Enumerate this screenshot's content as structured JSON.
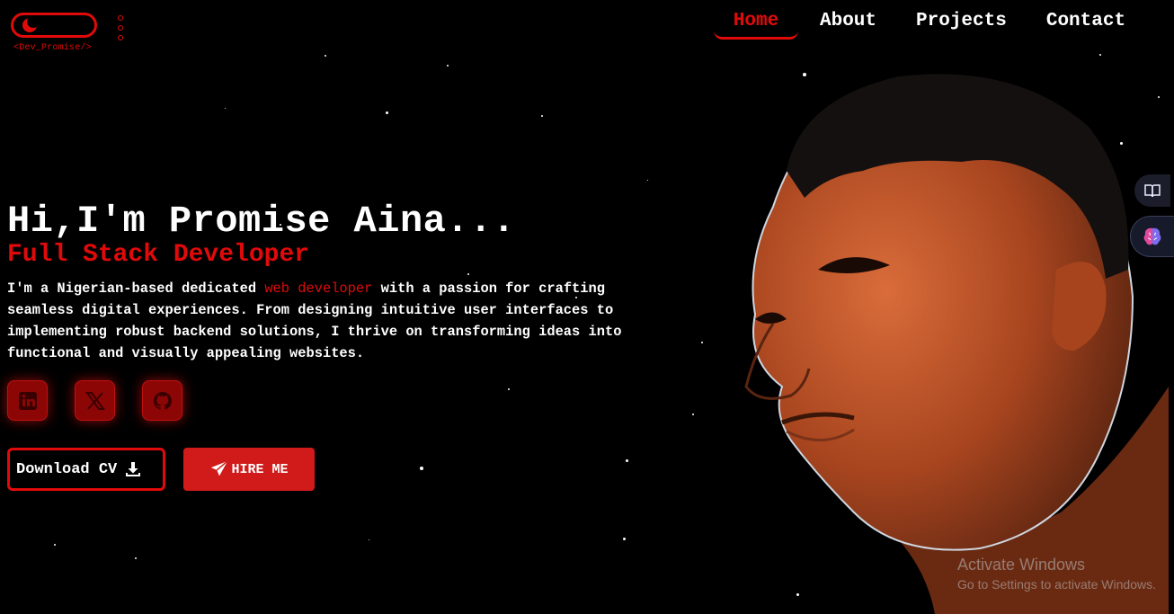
{
  "header": {
    "logo_text": "<Dev_Promise/>",
    "nav": [
      {
        "label": "Home",
        "active": true
      },
      {
        "label": "About",
        "active": false
      },
      {
        "label": "Projects",
        "active": false
      },
      {
        "label": "Contact",
        "active": false
      }
    ]
  },
  "hero": {
    "title": "Hi,I'm Promise Aina...",
    "role": "Full Stack Developer",
    "desc_before": "I'm a Nigerian-based dedicated ",
    "desc_highlight": "web developer",
    "desc_after": " with a passion for crafting seamless digital experiences. From designing intuitive user interfaces to implementing robust backend solutions, I thrive on transforming ideas into functional and visually appealing websites."
  },
  "social": [
    {
      "icon": "linkedin-icon"
    },
    {
      "icon": "x-twitter-icon"
    },
    {
      "icon": "github-icon"
    }
  ],
  "buttons": {
    "download_cv": "Download CV",
    "hire_me": "HIRE ME"
  },
  "watermark": {
    "title": "Activate Windows",
    "subtitle": "Go to Settings to activate Windows."
  },
  "colors": {
    "accent": "#e10a0a",
    "background": "#000000",
    "button_fill": "#d11a1a"
  }
}
